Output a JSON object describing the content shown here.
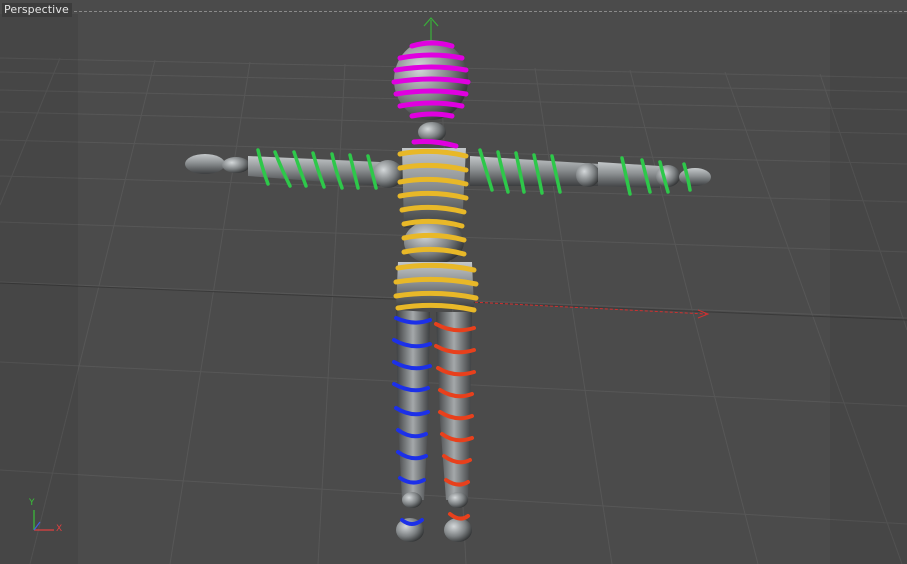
{
  "viewport": {
    "label": "Perspective"
  },
  "axis_gizmo": {
    "y_label": "Y",
    "x_label": "X",
    "y_color": "#38c238",
    "x_color": "#e04040",
    "z_color": "#4060e0"
  },
  "colors": {
    "background": "#4b4b4b",
    "grid_line": "#565656",
    "head_spiral": "#e000e0",
    "torso_spiral": "#e8b828",
    "arm_spiral": "#2ec84a",
    "left_leg_spiral": "#1c30e8",
    "right_leg_spiral": "#e8401c",
    "body": "#8a8e90"
  },
  "icons": {
    "up_handle": "arrow-up-icon",
    "x_handle": "arrow-right-icon"
  }
}
